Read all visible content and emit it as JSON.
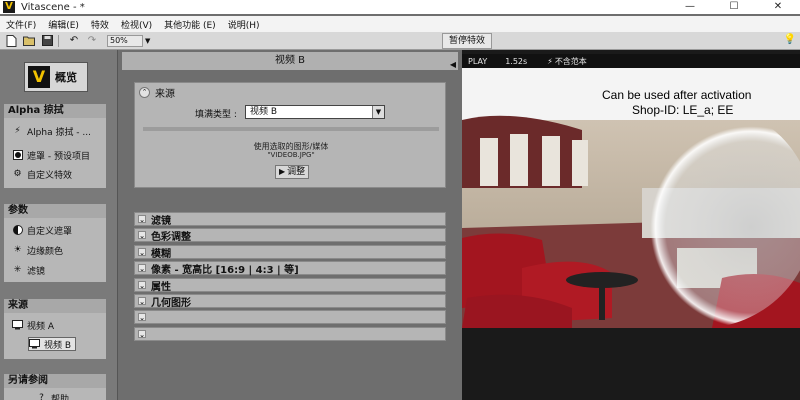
{
  "window": {
    "title": "Vitascene - *",
    "logo_letter": "V",
    "minimize": "—",
    "maximize": "☐",
    "close": "✕"
  },
  "menu": [
    "文件(F)",
    "编辑(E)",
    "特效",
    "检视(V)",
    "其他功能 (E)",
    "说明(H)"
  ],
  "toolbar": {
    "zoom": "50%",
    "pause_effect": "暂停特效"
  },
  "sidebar": {
    "overview_label": "概览",
    "sections": [
      {
        "title": "Alpha 掠拭",
        "items": [
          "Alpha 掠拭 - ...",
          "遮罩 - 预设项目",
          "自定义特效"
        ]
      },
      {
        "title": "参数",
        "items": [
          "自定义遮罩",
          "边缘颜色",
          "滤镜"
        ]
      },
      {
        "title": "来源",
        "items": [
          "视频 A",
          "视频 B"
        ]
      },
      {
        "title": "另请参阅",
        "items": [
          "帮助"
        ]
      }
    ],
    "selected_source": "视频 B"
  },
  "center": {
    "header": "视频 B",
    "source_title": "来源",
    "fill_type_label": "填满类型 :",
    "fill_type_value": "视频 B",
    "hint": "使用选取的图形/媒体",
    "file": "\"VIDEOB.JPG\"",
    "adjust_button": "调整",
    "accordion": [
      "滤镜",
      "色彩调整",
      "模糊",
      "像素 - 宽高比 [16:9 | 4:3 | 等]",
      "属性",
      "几何图形",
      "",
      ""
    ]
  },
  "preview": {
    "play_label": "PLAY",
    "time": "1.52s",
    "mode": "不含范本",
    "watermark_line1": "Can be used after activation",
    "watermark_line2": "Shop-ID:  LE_a; EE"
  },
  "colors": {
    "accent_yellow": "#f2c200",
    "panel_gray": "#b5b5b5",
    "dark_preview": "#1a1a1a"
  }
}
